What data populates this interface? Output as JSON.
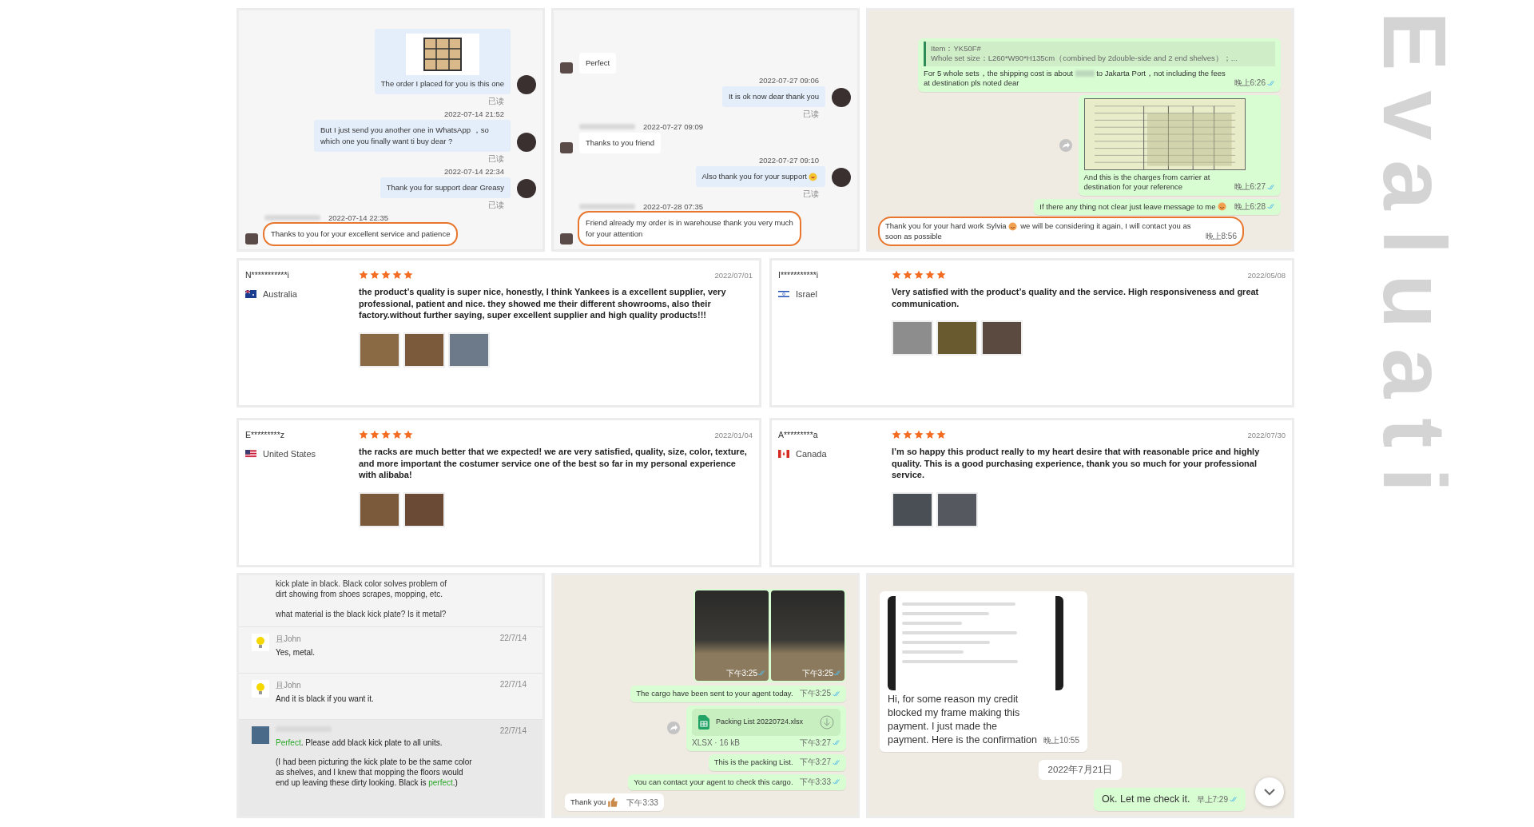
{
  "top_panels": [
    {
      "kind": "desk",
      "messages": [
        {
          "outgoing": true,
          "image": true,
          "text": "The order I placed for you is this one",
          "status": "已读",
          "highlighted": false
        },
        {
          "outgoing": true,
          "time": "2022-07-14 21:52",
          "text": "But I just send you another one in WhatsApp ，so which one you finally want ti buy dear ?",
          "status": "已读",
          "highlighted": false
        },
        {
          "outgoing": true,
          "time": "2022-07-14 22:34",
          "text": "Thank you for support dear Greasy",
          "status": "已读",
          "highlighted": false
        },
        {
          "outgoing": false,
          "time": "2022-07-14 22:35",
          "text": "Thanks to you for your excellent service and patience",
          "highlighted": true
        }
      ]
    },
    {
      "kind": "desk",
      "messages": [
        {
          "outgoing": false,
          "text": "Perfect",
          "highlighted": false
        },
        {
          "outgoing": true,
          "time": "2022-07-27 09:06",
          "text": "It is ok now dear thank you",
          "status": "已读",
          "highlighted": false
        },
        {
          "outgoing": false,
          "time": "2022-07-27 09:09",
          "text": "Thanks to you friend",
          "highlighted": false
        },
        {
          "outgoing": true,
          "time": "2022-07-27 09:10",
          "text": "Also thank you for your support",
          "emoji": {
            "kind": "laugh"
          },
          "status": "已读",
          "highlighted": false
        },
        {
          "outgoing": false,
          "time": "2022-07-28 07:35",
          "text": "Friend already my order is in warehouse thank you very much for your attention",
          "highlighted": true
        }
      ]
    },
    {
      "kind": "whatsapp",
      "messages": [
        {
          "kind": "quote",
          "outgoing": true,
          "quote_title": "Item：YK50F#",
          "quote_text": "Whole set size：L260*W90*H135cm（combined by 2double-side and 2 end shelves）；...",
          "text": "For 5 whole sets，the shipping cost is about",
          "text_after": "to Jakarta Port，not including the fees at destination pls noted dear",
          "time": "晚上6:26",
          "ticks": true,
          "highlighted": false
        },
        {
          "kind": "table_image",
          "outgoing": true,
          "forward": true,
          "text": "And this is the charges from carrier at destination for your reference",
          "time": "晚上6:27",
          "ticks": true,
          "highlighted": false
        },
        {
          "kind": "text",
          "outgoing": true,
          "text": "If there any thing not clear just leave message to me",
          "emoji": {
            "kind": "smile"
          },
          "time": "晚上6:28",
          "ticks": true,
          "highlighted": false
        },
        {
          "kind": "text",
          "outgoing": false,
          "text": "Thank you for your hard work Sylvia",
          "emoji": {
            "kind": "smile"
          },
          "text_after": "we will be considering it again, I will contact you as soon as possible",
          "time": "晚上8:56",
          "ticks": false,
          "highlighted": true
        }
      ]
    }
  ],
  "reviews": [
    {
      "name": "N***********i",
      "flag": {
        "kind": "au"
      },
      "country": "Australia",
      "stars": 5,
      "date": "2022/07/01",
      "text": "the product’s quality is super nice, honestly, I think Yankees is a excellent supplier, very professional, patient and nice. they showed me their different showrooms, also their factory.without further saying, super excellent supplier and high quality products!!!",
      "photos": [
        {
          "color": "#8a6a45"
        },
        {
          "color": "#7a5a3a"
        },
        {
          "color": "#6d7a8a"
        }
      ]
    },
    {
      "name": "I***********i",
      "flag": {
        "kind": "il"
      },
      "country": "Israel",
      "stars": 5,
      "date": "2022/05/08",
      "text": "Very satisfied with the product’s quality and the service. High responsiveness and great communication.",
      "photos": [
        {
          "color": "#8d8d8d"
        },
        {
          "color": "#6a5a30"
        },
        {
          "color": "#5a4a40"
        }
      ]
    },
    {
      "name": "E*********z",
      "flag": {
        "kind": "us"
      },
      "country": "United States",
      "stars": 5,
      "date": "2022/01/04",
      "text": "the racks are much better that we expected! we are very satisfied, quality, size, color, texture, and more important the costumer service one of the best so far in my personal experience with alibaba!",
      "photos": [
        {
          "color": "#7a5a3a"
        },
        {
          "color": "#6a4a35"
        }
      ]
    },
    {
      "name": "A*********a",
      "flag": {
        "kind": "ca"
      },
      "country": "Canada",
      "stars": 5,
      "date": "2022/07/30",
      "text": "I’m so happy this product really to my heart desire that with reasonable price and highly quality. This is a good purchasing experience, thank you so much for your professional service.",
      "photos": [
        {
          "color": "#4a4e55"
        },
        {
          "color": "#55595f"
        }
      ]
    }
  ],
  "bottom_panels": [
    {
      "kind": "forum",
      "quoted": [
        "kick plate in black. Black color solves problem of dirt showing from shoes scrapes, mopping, etc.",
        "what material is the black kick plate?  Is it metal?"
      ],
      "replies": [
        {
          "author": "且John",
          "avatar": {
            "kind": "bulb"
          },
          "date": "22/7/14",
          "selected": false,
          "paragraphs": [
            [
              {
                "text": "Yes, metal."
              }
            ]
          ]
        },
        {
          "author": "且John",
          "avatar": {
            "kind": "bulb"
          },
          "date": "22/7/14",
          "selected": false,
          "paragraphs": [
            [
              {
                "text": "And it is black if you want it."
              }
            ]
          ]
        },
        {
          "avatar": {
            "kind": "photo"
          },
          "date": "22/7/14",
          "selected": true,
          "paragraphs": [
            [
              {
                "text": "Perfect",
                "green": true
              },
              {
                "text": ". Please add black kick plate to all units."
              }
            ],
            [
              {
                "text": "(I had been picturing the kick plate to be the same color as shelves, and I knew that mopping the floors would end up leaving these dirty looking. Black is "
              },
              {
                "text": "perfect",
                "green": true
              },
              {
                "text": ".)"
              }
            ]
          ]
        }
      ]
    },
    {
      "kind": "whatsapp",
      "messages": [
        {
          "kind": "photos",
          "outgoing": true,
          "photos": [
            {
              "time": "下午3:25"
            },
            {
              "time": "下午3:25"
            }
          ],
          "ticks": true,
          "highlighted": false
        },
        {
          "kind": "text",
          "outgoing": true,
          "text": "The cargo have been sent to your agent today.",
          "time": "下午3:25",
          "ticks": true,
          "highlighted": false
        },
        {
          "kind": "file",
          "outgoing": true,
          "forward": true,
          "text": "Packing List 20220724.xlsx",
          "meta": "XLSX · 16 kB",
          "time": "下午3:27",
          "ticks": true,
          "highlighted": false
        },
        {
          "kind": "text",
          "outgoing": true,
          "text": "This is the packing List.",
          "time": "下午3:27",
          "ticks": true,
          "highlighted": false
        },
        {
          "kind": "text",
          "outgoing": true,
          "text": "You can contact your agent to check this cargo.",
          "time": "下午3:33",
          "ticks": true,
          "highlighted": false
        },
        {
          "kind": "text",
          "outgoing": false,
          "text": "Thank you",
          "emoji": {
            "kind": "thumbs"
          },
          "time": "下午3:33",
          "ticks": false,
          "highlighted": false
        }
      ]
    },
    {
      "kind": "whatsapp",
      "large": true,
      "scroll_button": true,
      "messages": [
        {
          "kind": "screenshot",
          "outgoing": false,
          "text": "Hi, for some reason my credit blocked my frame making this payment. I just made the payment. Here is the confirmation",
          "time": "晚上10:55",
          "ticks": false,
          "highlighted": false
        },
        {
          "kind": "date",
          "text": "2022年7月21日"
        },
        {
          "kind": "text",
          "outgoing": true,
          "text": "Ok. Let me check it.",
          "time": "早上7:29",
          "ticks": true,
          "highlighted": false
        }
      ]
    }
  ],
  "decor_title": "Evaluati"
}
